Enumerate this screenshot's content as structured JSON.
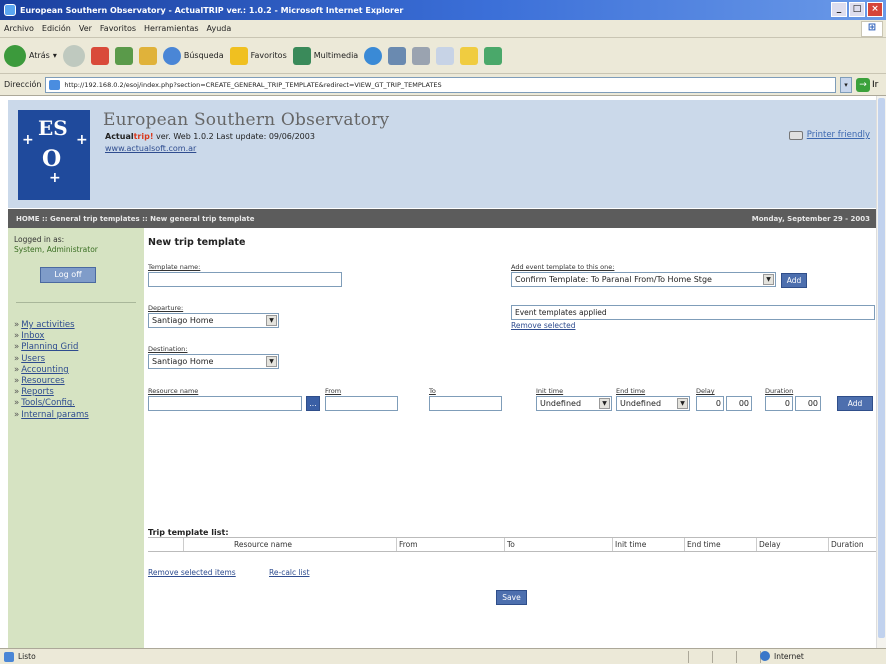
{
  "window": {
    "title": "European Southern Observatory - ActualTRIP ver.: 1.0.2 - Microsoft Internet Explorer",
    "buttons": [
      "_",
      "□",
      "×"
    ]
  },
  "menubar": [
    "Archivo",
    "Edición",
    "Ver",
    "Favoritos",
    "Herramientas",
    "Ayuda"
  ],
  "toolbar": {
    "back": "Atrás",
    "search": "Búsqueda",
    "favorites": "Favoritos",
    "multimedia": "Multimedia"
  },
  "address": {
    "label": "Dirección",
    "url": "http://192.168.0.2/esoj/index.php?section=CREATE_GENERAL_TRIP_TEMPLATE&redirect=VIEW_GT_TRIP_TEMPLATES",
    "go": "Ir"
  },
  "header": {
    "logo_top": "ES",
    "logo_bottom": "O",
    "org": "European Southern Observatory",
    "version_actual": "Actual",
    "version_trip": "trip!",
    "version_rest": " ver. Web 1.0.2 Last update: 09/06/2003",
    "site": "www.actualsoft.com.ar",
    "printer": "Printer friendly"
  },
  "breadcrumb": {
    "path": "HOME :: General trip templates :: New general trip template",
    "date": "Monday, September 29 - 2003"
  },
  "sidebar": {
    "logged_label": "Logged in as:",
    "user": "System, Administrator",
    "logoff": "Log off",
    "items": [
      "My activities",
      "Inbox",
      "Planning Grid",
      "Users",
      "Accounting",
      "Resources",
      "Reports",
      "Tools/Config.",
      "Internal params"
    ]
  },
  "form": {
    "title": "New trip template",
    "template_name_label": "Template name:",
    "template_name_value": "",
    "add_event_label": "Add event template to this one:",
    "add_event_value": "Confirm Template: To Paranal From/To Home Stge",
    "add_btn": "Add",
    "departure_label": "Departure:",
    "departure_value": "Santiago Home",
    "event_templates_label": "Event templates applied",
    "remove_selected_link": "Remove selected",
    "destination_label": "Destination:",
    "destination_value": "Santiago Home",
    "resource_name_label": "Resource name",
    "resource_browse": "...",
    "from_label": "From",
    "to_label": "To",
    "init_time_label": "Init time",
    "init_time_value": "Undefined",
    "end_time_label": "End time",
    "end_time_value": "Undefined",
    "delay_label": "Delay",
    "delay_h": "0",
    "delay_m": "00",
    "duration_label": "Duration",
    "duration_h": "0",
    "duration_m": "00",
    "add_row_btn": "Add",
    "list_title": "Trip template list:",
    "columns": [
      "Resource name",
      "From",
      "To",
      "Init time",
      "End time",
      "Delay",
      "Duration"
    ],
    "remove_selected_items": "Remove selected items",
    "recalc_list": "Re-calc list",
    "save_btn": "Save"
  },
  "status": {
    "text": "Listo",
    "zone": "Internet"
  }
}
